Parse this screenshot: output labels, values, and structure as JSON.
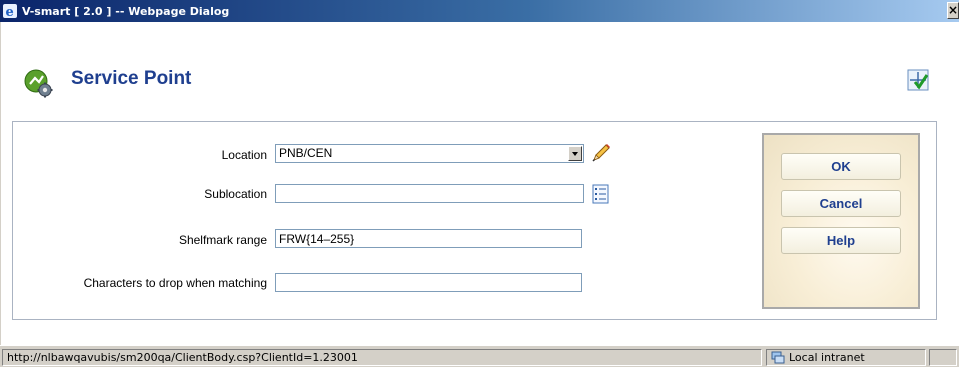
{
  "window": {
    "title": "V-smart [ 2.0 ] -- Webpage Dialog",
    "close_label": "×"
  },
  "header": {
    "title": "Service Point",
    "icon": "service-point-gear-icon",
    "settings_icon": "settings-checkmark-icon"
  },
  "form": {
    "location": {
      "label": "Location",
      "value": "PNB/CEN",
      "edit_icon": "pencil-icon"
    },
    "sublocation": {
      "label": "Sublocation",
      "value": "",
      "list_icon": "list-icon"
    },
    "shelfmark": {
      "label": "Shelfmark range",
      "value": "FRW{14–255}"
    },
    "characters": {
      "label": "Characters to drop when matching",
      "value": ""
    }
  },
  "buttons": {
    "ok": "OK",
    "cancel": "Cancel",
    "help": "Help"
  },
  "statusbar": {
    "url": "http://nlbawqavubis/sm200qa/ClientBody.csp?ClientId=1.23001",
    "zone": "Local intranet"
  },
  "colors": {
    "title_blue": "#1f3f8f",
    "titlebar_start": "#0a246a",
    "titlebar_end": "#a6caf0"
  }
}
